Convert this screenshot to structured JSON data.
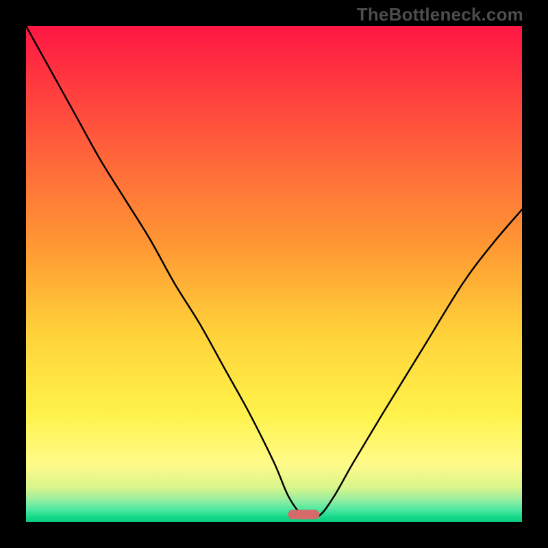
{
  "watermark": "TheBottleneck.com",
  "chart_data": {
    "type": "line",
    "title": "",
    "xlabel": "",
    "ylabel": "",
    "xlim": [
      0,
      100
    ],
    "ylim": [
      0,
      100
    ],
    "grid": false,
    "marker": {
      "x": 56,
      "y": 1.5,
      "color": "#d46a6a"
    },
    "series": [
      {
        "name": "bottleneck-curve",
        "x": [
          0,
          5,
          10,
          15,
          20,
          25,
          30,
          35,
          40,
          45,
          50,
          53,
          56,
          59,
          62,
          66,
          72,
          80,
          88,
          94,
          100
        ],
        "y": [
          100,
          91,
          82,
          73,
          65,
          57,
          48,
          40,
          31,
          22,
          12,
          5,
          1.2,
          1.2,
          5,
          12,
          22,
          35,
          48,
          56,
          63
        ]
      }
    ],
    "background_gradient": {
      "stops": [
        {
          "offset": 0.0,
          "color": "#ff1744"
        },
        {
          "offset": 0.12,
          "color": "#ff3b3f"
        },
        {
          "offset": 0.28,
          "color": "#ff6a3a"
        },
        {
          "offset": 0.45,
          "color": "#ff9a33"
        },
        {
          "offset": 0.62,
          "color": "#ffd23a"
        },
        {
          "offset": 0.78,
          "color": "#fff24a"
        },
        {
          "offset": 0.885,
          "color": "#fffb8a"
        },
        {
          "offset": 0.93,
          "color": "#d9f58a"
        },
        {
          "offset": 0.955,
          "color": "#98eea0"
        },
        {
          "offset": 0.975,
          "color": "#4de8a0"
        },
        {
          "offset": 0.99,
          "color": "#15d98a"
        },
        {
          "offset": 1.0,
          "color": "#0cc97e"
        }
      ]
    }
  }
}
